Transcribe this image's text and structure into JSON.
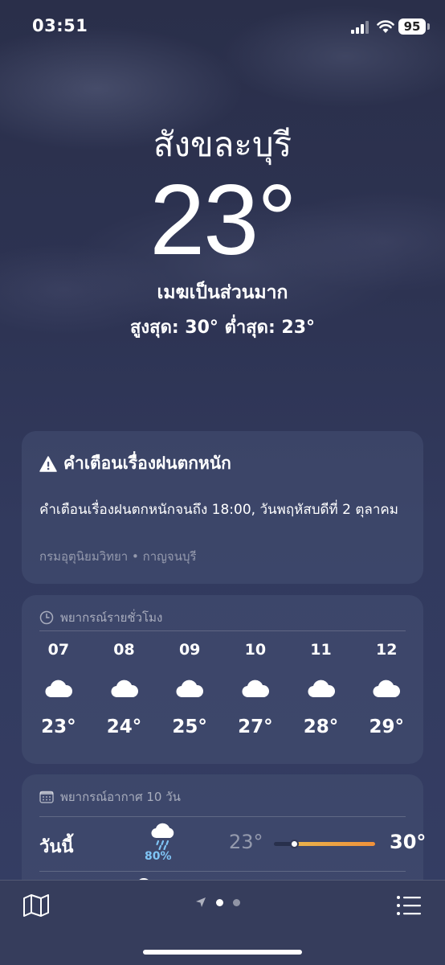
{
  "status_bar": {
    "time": "03:51",
    "battery": "95"
  },
  "hero": {
    "city": "สังขละบุรี",
    "temperature": "23°",
    "condition": "เมฆเป็นส่วนมาก",
    "high_low": "สูงสุด: 30°  ต่ำสุด: 23°"
  },
  "alert": {
    "title": "คำเตือนเรื่องฝนตกหนัก",
    "body": "คำเตือนเรื่องฝนตกหนักจนถึง 18:00, วันพฤหัสบดีที่ 2 ตุลาคม",
    "source": "กรมอุตุนิยมวิทยา • กาญจนบุรี",
    "icon": "warning-triangle-icon"
  },
  "hourly": {
    "header": "พยากรณ์รายชั่วโมง",
    "icon": "clock-icon",
    "items": [
      {
        "hour": "07",
        "icon": "cloud-icon",
        "temp": "23°"
      },
      {
        "hour": "08",
        "icon": "cloud-icon",
        "temp": "24°"
      },
      {
        "hour": "09",
        "icon": "cloud-icon",
        "temp": "25°"
      },
      {
        "hour": "10",
        "icon": "cloud-icon",
        "temp": "27°"
      },
      {
        "hour": "11",
        "icon": "cloud-icon",
        "temp": "28°"
      },
      {
        "hour": "12",
        "icon": "cloud-icon",
        "temp": "29°"
      }
    ]
  },
  "daily": {
    "header": "พยากรณ์อากาศ 10 วัน",
    "icon": "calendar-icon",
    "rows": [
      {
        "day": "วันนี้",
        "icon": "cloud-rain-icon",
        "rain_chance": "80%",
        "low": "23°",
        "high": "30°",
        "current_position": 0.0
      }
    ]
  },
  "colors": {
    "accent_rain": "#7fc4f5",
    "range_start": "#e9b44c",
    "range_end": "#f0913a"
  }
}
